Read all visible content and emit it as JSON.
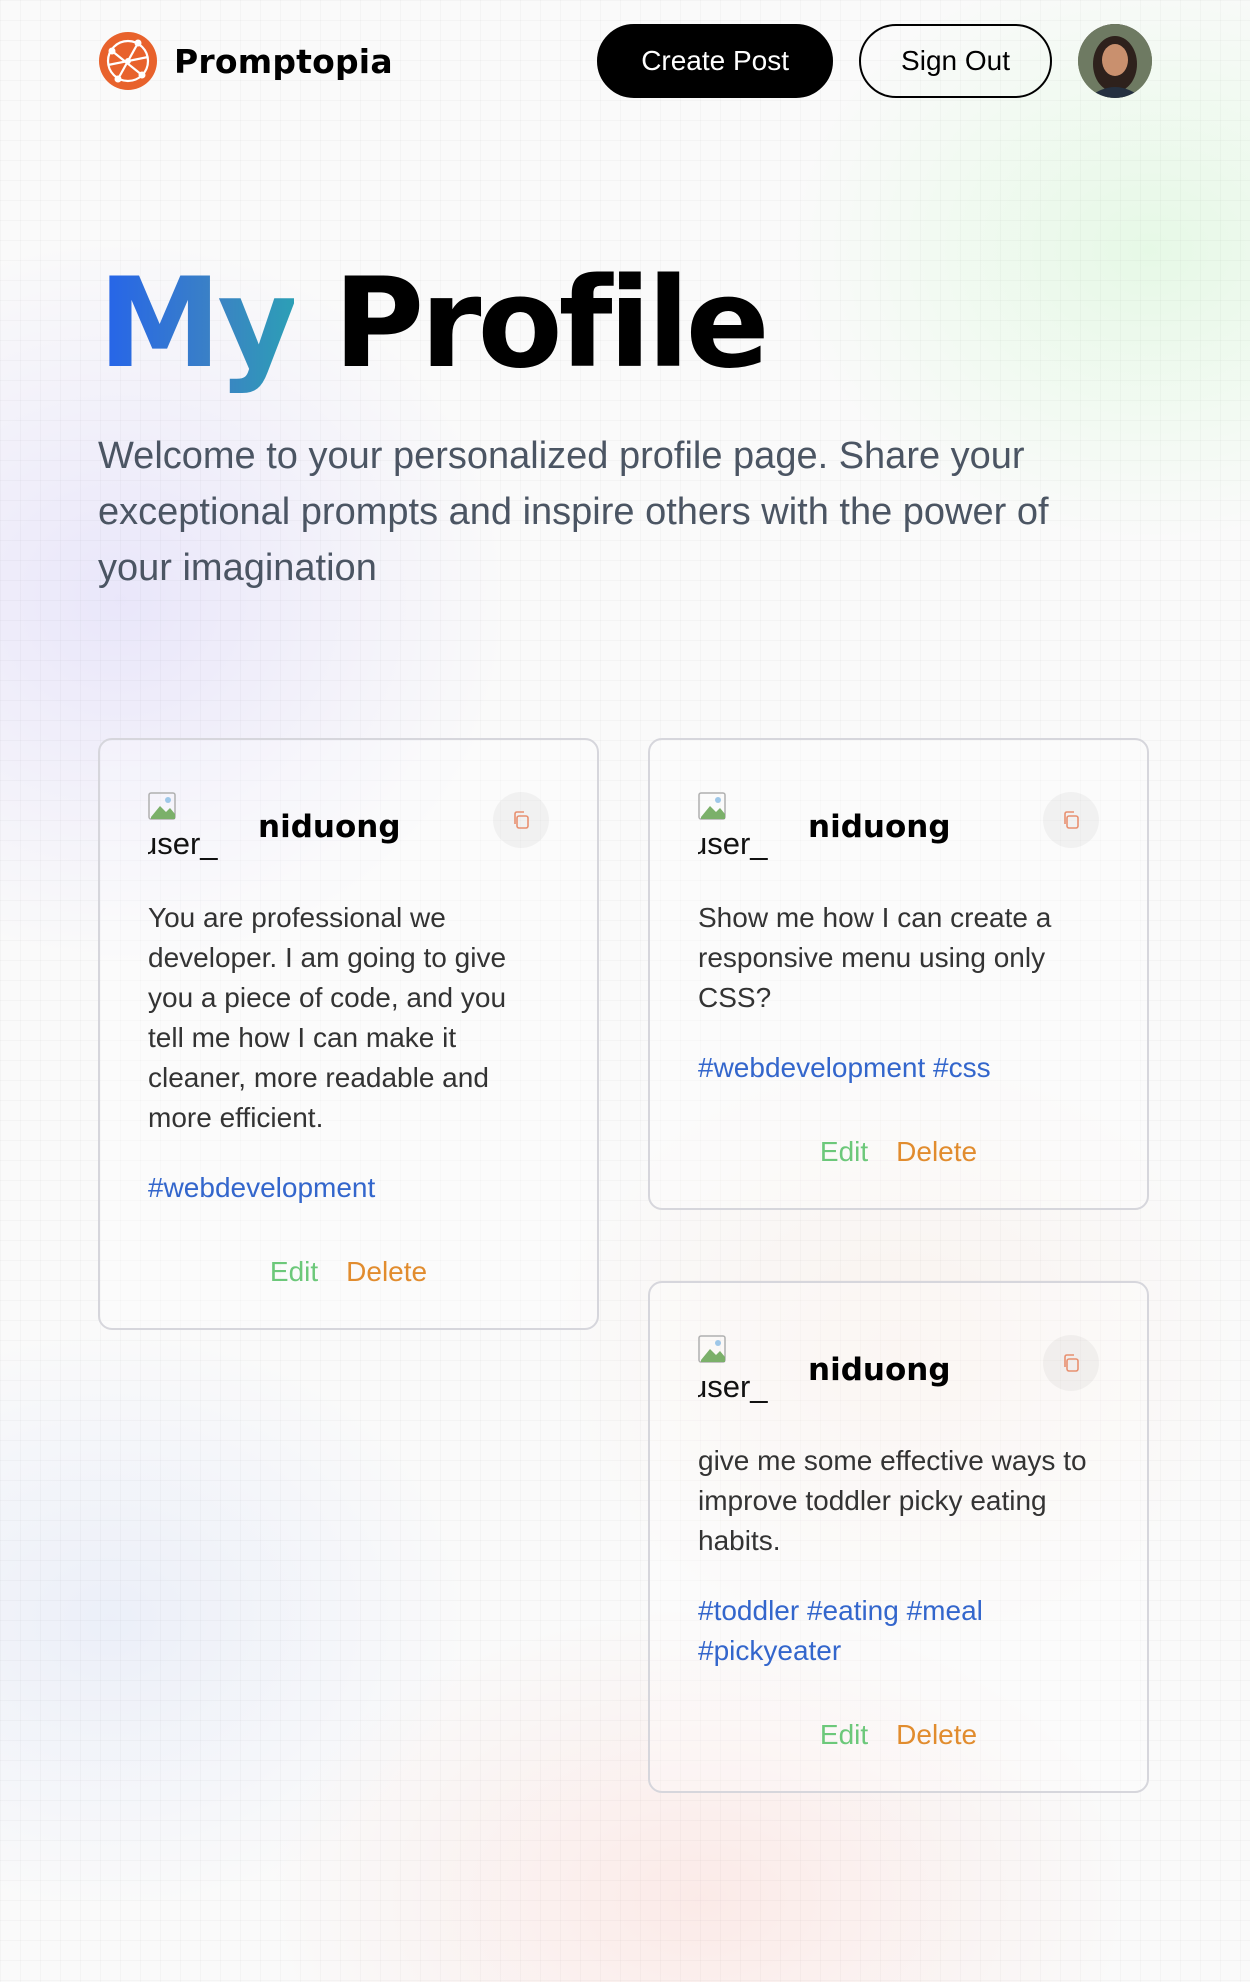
{
  "nav": {
    "brand": "Promptopia",
    "create_post": "Create Post",
    "sign_out": "Sign Out"
  },
  "header": {
    "title_accent": "My",
    "title_rest": "Profile",
    "description": "Welcome to your personalized profile page. Share your exceptional prompts and inspire others with the power of your imagination"
  },
  "colors": {
    "accent_blue": "#2563eb",
    "brand_orange": "#e8622c",
    "tag_blue": "#3366cc",
    "edit_green": "#6cc87a",
    "delete_orange": "#e18c2e"
  },
  "posts": [
    {
      "user_img_alt": "user_",
      "username": "niduong",
      "prompt": "You are professional we developer. I am going to give you a piece of code, and you tell me how I can make it cleaner, more readable and more efficient.",
      "tags": "#webdevelopment",
      "edit": "Edit",
      "delete": "Delete"
    },
    {
      "user_img_alt": "user_",
      "username": "niduong",
      "prompt": "Show me how I can create a responsive menu using only CSS?",
      "tags": "#webdevelopment #css",
      "edit": "Edit",
      "delete": "Delete"
    },
    {
      "user_img_alt": "user_",
      "username": "niduong",
      "prompt": "give me some effective ways to improve toddler picky eating habits.",
      "tags": "#toddler #eating #meal #pickyeater",
      "edit": "Edit",
      "delete": "Delete"
    }
  ]
}
